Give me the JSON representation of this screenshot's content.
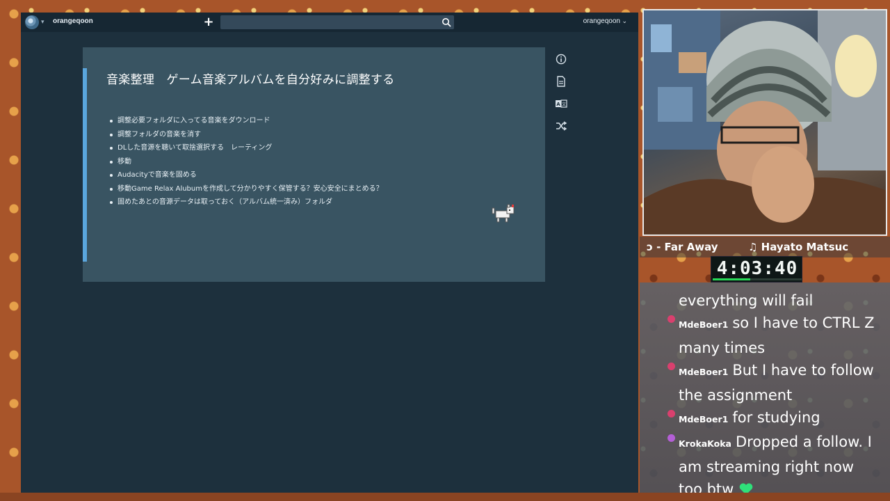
{
  "header": {
    "username_left": "orangeqoon",
    "username_right": "orangeqoon",
    "search_placeholder": ""
  },
  "card": {
    "title": "音楽整理　ゲーム音楽アルバムを自分好みに調整する",
    "items": [
      "調整必要フォルダに入ってる音楽をダウンロード",
      "調整フォルダの音楽を消す",
      "DLした音源を聴いて取捨選択する　レーティング",
      "移動",
      "Audacityで音楽を固める",
      "移動Game Relax Alubumを作成して分かりやすく保管する？安心安全にまとめる？",
      "固めたあとの音源データは取っておく（アルバム統一済み）フォルダ"
    ]
  },
  "side_icons": [
    "info-icon",
    "document-icon",
    "translate-icon",
    "shuffle-icon"
  ],
  "ticker": {
    "song": "ɔ - Far Away",
    "artist": "♫ Hayato Matsuc"
  },
  "timer": {
    "value": "4:03:40",
    "progress_fraction": 0.42,
    "progress_color": "#27d957"
  },
  "chat": {
    "lines": [
      {
        "user": "",
        "text": "everything will fail",
        "badge_color": ""
      },
      {
        "user": "MdeBoer1",
        "text": "so I have to CTRL Z many times",
        "badge_color": "#d9406e"
      },
      {
        "user": "MdeBoer1",
        "text": "But I have to follow the assignment",
        "badge_color": "#d9406e"
      },
      {
        "user": "MdeBoer1",
        "text": "for studying",
        "badge_color": "#d9406e"
      },
      {
        "user": "KrokaKoka",
        "text": "Dropped a follow. I am streaming right now too btw",
        "badge_color": "#b45fd6"
      }
    ],
    "heart_color": "#2fe07a"
  },
  "colors": {
    "app_bg": "#1d303d",
    "card_bg": "#395462",
    "accent": "#5aa6dd"
  }
}
